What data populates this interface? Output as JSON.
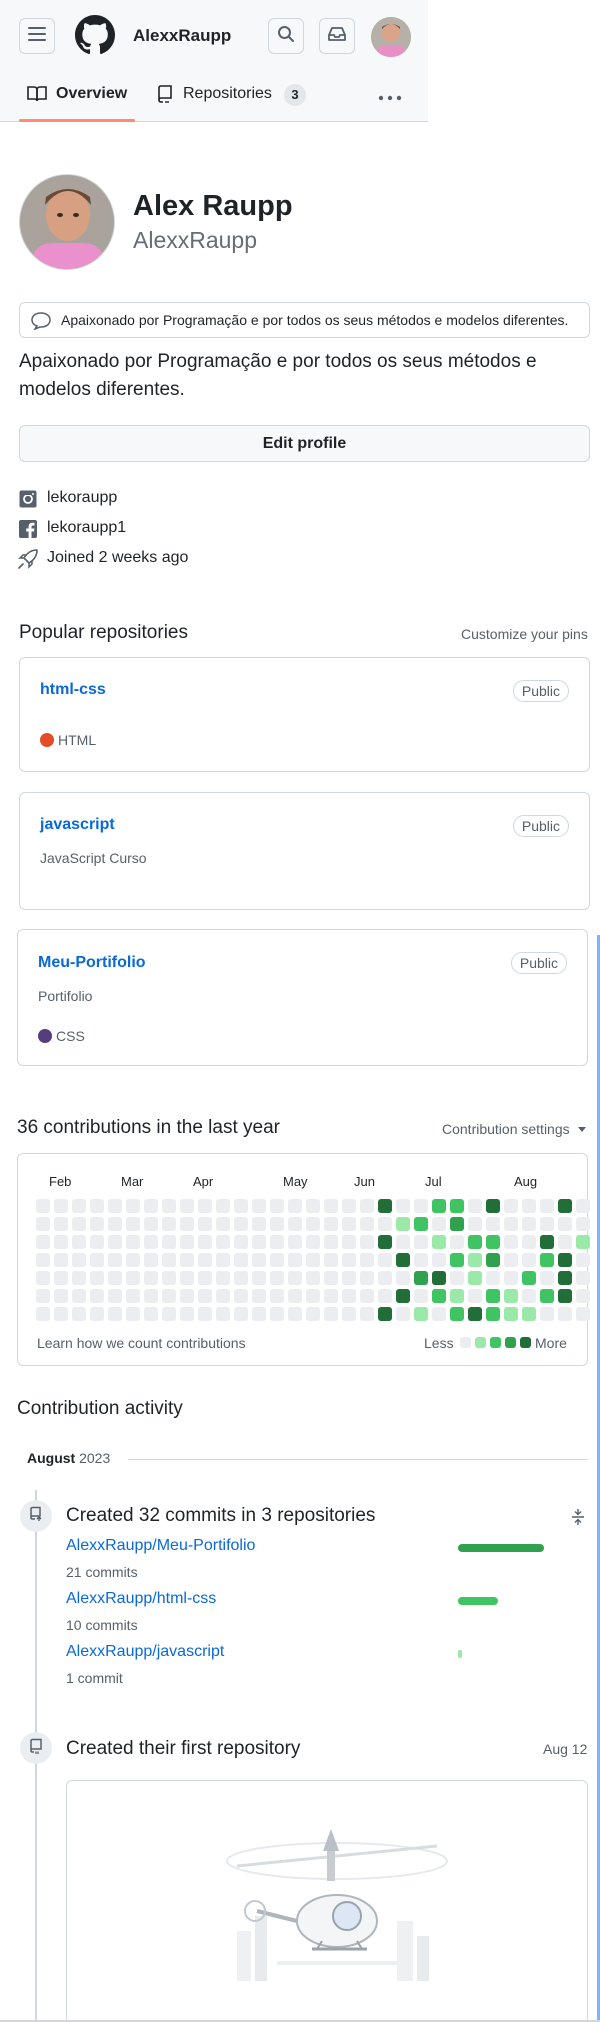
{
  "header": {
    "username": "AlexxRaupp",
    "tabs": [
      {
        "label": "Overview"
      },
      {
        "label": "Repositories",
        "count": "3"
      }
    ]
  },
  "profile": {
    "full_name": "Alex Raupp",
    "username": "AlexxRaupp",
    "status": "Apaixonado por Programação e por todos os seus métodos e modelos diferentes.",
    "bio": "Apaixonado por Programação e por todos os seus métodos e modelos diferentes.",
    "edit_button": "Edit profile",
    "instagram": "lekoraupp",
    "facebook": "lekoraupp1",
    "joined": "Joined 2 weeks ago"
  },
  "popular": {
    "title": "Popular repositories",
    "customize": "Customize your pins",
    "repos": [
      {
        "name": "html-css",
        "visibility": "Public",
        "description": "",
        "language": "HTML",
        "lang_color": "#e34c26"
      },
      {
        "name": "javascript",
        "visibility": "Public",
        "description": "JavaScript Curso",
        "language": "",
        "lang_color": ""
      },
      {
        "name": "Meu-Portifolio",
        "visibility": "Public",
        "description": "Portifolio",
        "language": "CSS",
        "lang_color": "#563d7c"
      }
    ]
  },
  "contributions": {
    "title": "36 contributions in the last year",
    "settings": "Contribution settings",
    "months": [
      "Feb",
      "Mar",
      "Apr",
      "May",
      "Jun",
      "Jul",
      "Aug"
    ],
    "learn": "Learn how we count contributions",
    "less": "Less",
    "more": "More",
    "colors": [
      "#ebedf0",
      "#9be9a8",
      "#40c463",
      "#30a14e",
      "#216e39"
    ]
  },
  "activity": {
    "title": "Contribution activity",
    "month": "August",
    "year": "2023",
    "commits_title": "Created 32 commits in 3 repositories",
    "commit_repos": [
      {
        "name": "AlexxRaupp/Meu-Portifolio",
        "commits": "21 commits",
        "share": 0.66
      },
      {
        "name": "AlexxRaupp/html-css",
        "commits": "10 commits",
        "share": 0.31
      },
      {
        "name": "AlexxRaupp/javascript",
        "commits": "1 commit",
        "share": 0.03
      }
    ],
    "first_repo_title": "Created their first repository",
    "first_repo_date": "Aug 12"
  }
}
